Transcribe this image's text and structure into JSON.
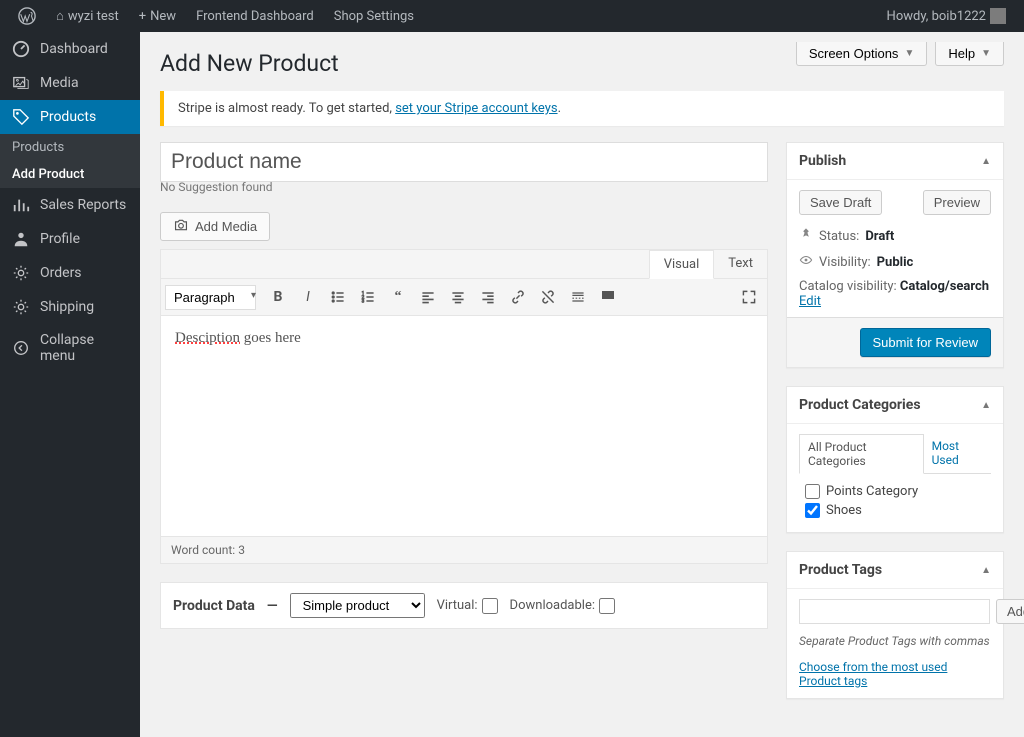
{
  "adminbar": {
    "site_name": "wyzi test",
    "new": "New",
    "frontend": "Frontend Dashboard",
    "shop": "Shop Settings",
    "howdy": "Howdy, boib1222"
  },
  "sidebar": {
    "dashboard": "Dashboard",
    "media": "Media",
    "products": "Products",
    "sub_products": "Products",
    "sub_add": "Add Product",
    "sales": "Sales Reports",
    "profile": "Profile",
    "orders": "Orders",
    "shipping": "Shipping",
    "collapse": "Collapse menu"
  },
  "topbuttons": {
    "screen": "Screen Options",
    "help": "Help"
  },
  "page_title": "Add New Product",
  "notice": {
    "pre": "Stripe is almost ready. To get started, ",
    "link": "set your Stripe account keys",
    "post": "."
  },
  "title_field": {
    "placeholder": "Product name",
    "suggest": "No Suggestion found"
  },
  "media_btn": "Add Media",
  "editor": {
    "visual": "Visual",
    "text": "Text",
    "format": "Paragraph",
    "content_misspell": "Desciption",
    "content_rest": " goes here",
    "wordcount_label": "Word count: ",
    "wordcount": "3"
  },
  "product_data": {
    "label": "Product Data",
    "sep": "—",
    "type": "Simple product",
    "virtual": "Virtual:",
    "downloadable": "Downloadable:"
  },
  "publish": {
    "title": "Publish",
    "save_draft": "Save Draft",
    "preview": "Preview",
    "status_label": "Status:",
    "status_value": "Draft",
    "vis_label": "Visibility:",
    "vis_value": "Public",
    "catvis_label": "Catalog visibility:",
    "catvis_value": "Catalog/search",
    "edit": "Edit",
    "submit": "Submit for Review"
  },
  "categories": {
    "title": "Product Categories",
    "tab_all": "All Product Categories",
    "tab_most": "Most Used",
    "items": [
      {
        "label": "Points Category",
        "checked": false
      },
      {
        "label": "Shoes",
        "checked": true
      }
    ]
  },
  "tags": {
    "title": "Product Tags",
    "add": "Add",
    "hint": "Separate Product Tags with commas",
    "choose": "Choose from the most used Product tags"
  }
}
